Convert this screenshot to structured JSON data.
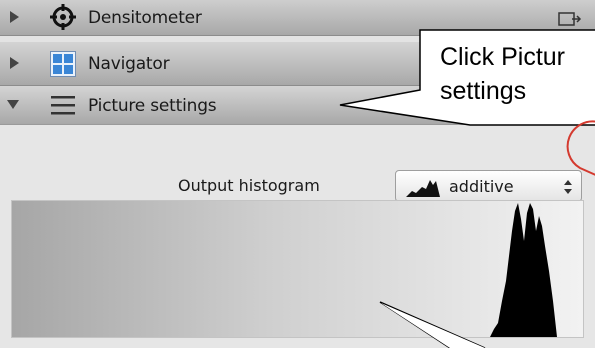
{
  "panels": [
    {
      "label": "Densitometer",
      "icon": "crosshair-icon",
      "expanded": false
    },
    {
      "label": "Navigator",
      "icon": "navigator-grid-icon",
      "expanded": false
    },
    {
      "label": "Picture settings",
      "icon": "list-lines-icon",
      "expanded": true
    }
  ],
  "picture_settings": {
    "output_histogram_label": "Output histogram",
    "output_histogram_value": "additive"
  },
  "callout": {
    "text": "Click Pictur\nsettings"
  },
  "colors": {
    "header_gradient_top": "#d4d4d4",
    "header_gradient_bottom": "#a8a8a8",
    "panel_background": "#e6e6e6",
    "callout_circle": "#d43a2f"
  }
}
